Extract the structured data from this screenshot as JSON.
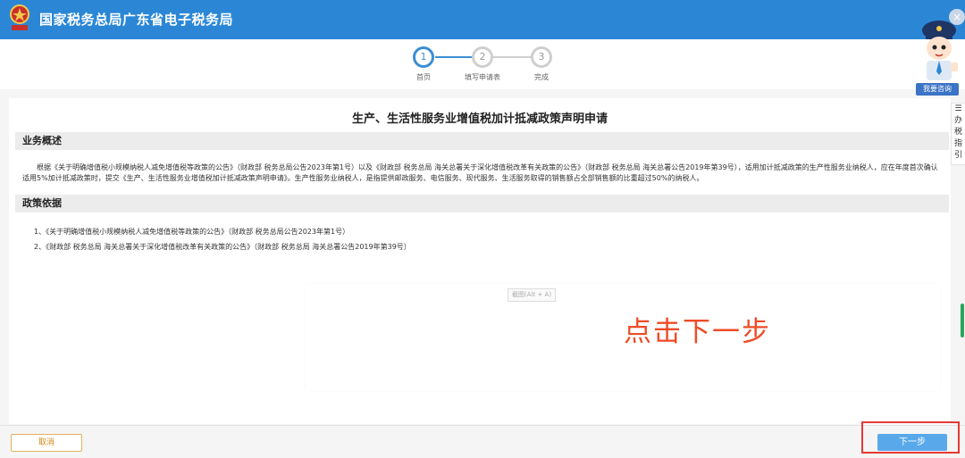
{
  "header": {
    "app_title": "国家税务总局广东省电子税务局",
    "close_symbol": "×"
  },
  "steps": [
    {
      "number": "1",
      "label": "首页",
      "active": true
    },
    {
      "number": "2",
      "label": "填写申请表",
      "active": false
    },
    {
      "number": "3",
      "label": "完成",
      "active": false
    }
  ],
  "main": {
    "title": "生产、生活性服务业增值税加计抵减政策声明申请",
    "overview": {
      "heading": "业务概述",
      "text": "根据《关于明确增值税小规模纳税人减免增值税等政策的公告》（财政部 税务总局公告2023年第1号）以及《财政部 税务总局 海关总署关于深化增值税改革有关政策的公告》（财政部 税务总局 海关总署公告2019年第39号），适用加计抵减政策的生产性服务业纳税人，应在年度首次确认适用5%加计抵减政策时，提交《生产、生活性服务业增值税加计抵减政策声明申请》。生产性服务业纳税人，是指提供邮政服务、电信服务、现代服务、生活服务取得的销售额占全部销售额的比重超过50%的纳税人。"
    },
    "basis": {
      "heading": "政策依据",
      "items": [
        "1、《关于明确增值税小规模纳税人减免增值税等政策的公告》（财政部 税务总局公告2023年第1号）",
        "2、《财政部 税务总局 海关总署关于深化增值税改革有关政策的公告》（财政部 税务总局 海关总署公告2019年第39号）"
      ]
    },
    "screenshot_tooltip": "截图(Alt + A)",
    "annotation": "点击下一步"
  },
  "footer": {
    "cancel_label": "取消",
    "next_label": "下一步"
  },
  "assistant": {
    "consult_label": "我要咨询"
  },
  "side_guide": {
    "icon": "☰",
    "text": [
      "办",
      "税",
      "指",
      "引"
    ]
  },
  "colors": {
    "header_bg": "#2b87d6",
    "step_active": "#3b8ed4",
    "next_button": "#59a9ea",
    "cancel_border": "#e3b35a",
    "annotation": "#ee4b27",
    "highlight": "#e53935"
  }
}
